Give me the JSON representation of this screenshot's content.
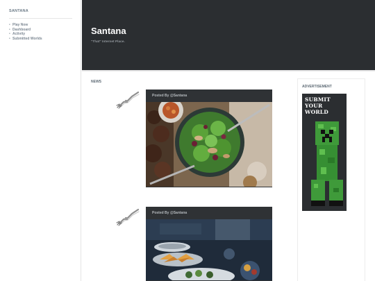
{
  "sidebar": {
    "brand": "SANTANA",
    "nav": [
      {
        "label": "Play Now"
      },
      {
        "label": "Dashboard"
      },
      {
        "label": "Activity"
      },
      {
        "label": "Submitted Worlds"
      }
    ]
  },
  "header": {
    "title": "Santana",
    "tagline": "\"That\" Internet Place."
  },
  "news": {
    "heading": "NEWS",
    "posts": [
      {
        "byline": "Posted By @Santana",
        "image": "salad-bowl-photo",
        "avatar": "skeleton-arm-icon"
      },
      {
        "byline": "Posted By @Santana",
        "image": "buffet-food-photo",
        "avatar": "skeleton-arm-icon"
      }
    ]
  },
  "advertisement": {
    "heading": "ADVERTISEMENT",
    "lines": [
      "SUBMIT",
      "YOUR",
      "WORLD"
    ],
    "image": "creeper-figure",
    "colors": {
      "panel": "#2b2e31",
      "creeper": "#3f9a3a"
    }
  },
  "colors": {
    "header_bg": "#2b2e31",
    "card_bg": "#2f3235",
    "muted_text": "#7d8893"
  }
}
